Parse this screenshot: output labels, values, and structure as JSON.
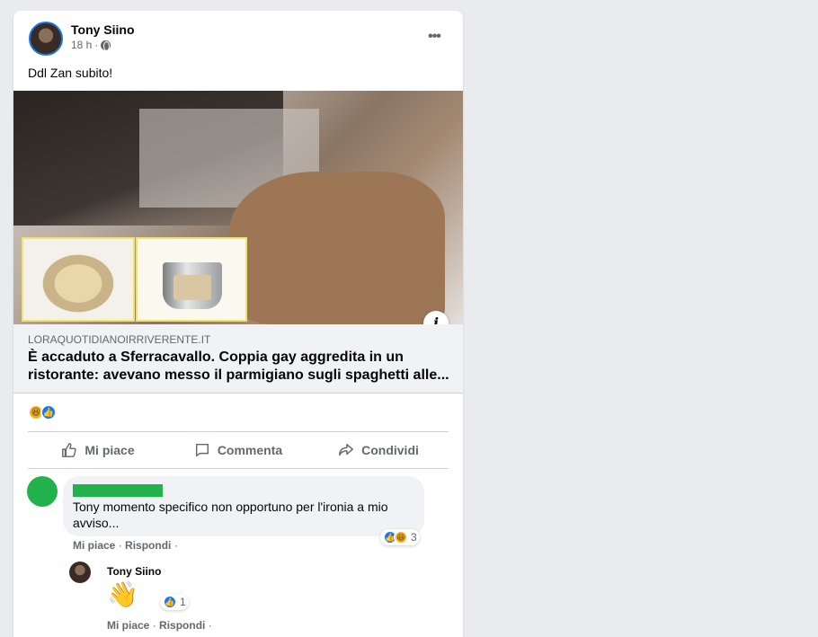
{
  "post": {
    "author": "Tony Siino",
    "time": "18 h",
    "separator": "·",
    "text": "Ddl Zan subito!",
    "image_icons": [
      "photo-scene",
      "info-icon"
    ],
    "link": {
      "domain": "LORAQUOTIDIANOIRRIVERENTE.IT",
      "title": "È accaduto a Sferracavallo. Coppia gay aggredita in un ristorante: avevano messo il parmigiano sugli spaghetti alle..."
    },
    "reactions": [
      "haha-icon",
      "like-icon"
    ]
  },
  "actions": {
    "like": "Mi piace",
    "comment": "Commenta",
    "share": "Condividi"
  },
  "comments": [
    {
      "text": "Tony momento specifico non opportuno per l'ironia a mio avviso...",
      "like_label": "Mi piace",
      "reply_label": "Rispondi",
      "dot": "·",
      "reaction_count": "3"
    }
  ],
  "reply": {
    "author": "Tony Siino",
    "emoji": "👋",
    "like_label": "Mi piace",
    "reply_label": "Rispondi",
    "dot": "·",
    "reaction_count": "1"
  },
  "colors": {
    "facebook_blue": "#1877f2",
    "text_secondary": "#65676b",
    "redaction_green": "#21b24b"
  }
}
